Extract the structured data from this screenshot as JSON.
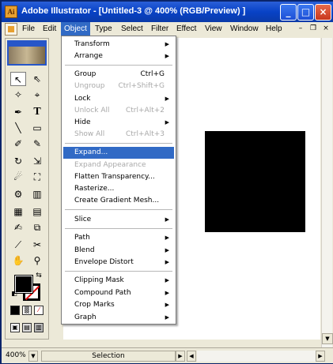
{
  "window": {
    "title": "Adobe Illustrator - [Untitled-3 @ 400% (RGB/Preview) ]",
    "app_icon_text": "Ai",
    "controls": {
      "minimize": "_",
      "maximize": "□",
      "close": "×"
    }
  },
  "menubar": {
    "items": [
      "File",
      "Edit",
      "Object",
      "Type",
      "Select",
      "Filter",
      "Effect",
      "View",
      "Window",
      "Help"
    ],
    "active": "Object",
    "mdi": {
      "minimize": "–",
      "restore": "❐",
      "close": "×"
    }
  },
  "object_menu": {
    "items": [
      {
        "label": "Transform",
        "shortcut": "",
        "submenu": true,
        "disabled": false
      },
      {
        "label": "Arrange",
        "shortcut": "",
        "submenu": true,
        "disabled": false
      },
      {
        "label": "Group",
        "shortcut": "Ctrl+G",
        "submenu": false,
        "disabled": false
      },
      {
        "label": "Ungroup",
        "shortcut": "Ctrl+Shift+G",
        "submenu": false,
        "disabled": true
      },
      {
        "label": "Lock",
        "shortcut": "",
        "submenu": true,
        "disabled": false
      },
      {
        "label": "Unlock All",
        "shortcut": "Ctrl+Alt+2",
        "submenu": false,
        "disabled": true
      },
      {
        "label": "Hide",
        "shortcut": "",
        "submenu": true,
        "disabled": false
      },
      {
        "label": "Show All",
        "shortcut": "Ctrl+Alt+3",
        "submenu": false,
        "disabled": true
      },
      {
        "label": "Expand...",
        "shortcut": "",
        "submenu": false,
        "disabled": false,
        "highlighted": true
      },
      {
        "label": "Expand Appearance",
        "shortcut": "",
        "submenu": false,
        "disabled": true
      },
      {
        "label": "Flatten Transparency...",
        "shortcut": "",
        "submenu": false,
        "disabled": false
      },
      {
        "label": "Rasterize...",
        "shortcut": "",
        "submenu": false,
        "disabled": false
      },
      {
        "label": "Create Gradient Mesh...",
        "shortcut": "",
        "submenu": false,
        "disabled": false
      },
      {
        "label": "Slice",
        "shortcut": "",
        "submenu": true,
        "disabled": false
      },
      {
        "label": "Path",
        "shortcut": "",
        "submenu": true,
        "disabled": false
      },
      {
        "label": "Blend",
        "shortcut": "",
        "submenu": true,
        "disabled": false
      },
      {
        "label": "Envelope Distort",
        "shortcut": "",
        "submenu": true,
        "disabled": false
      },
      {
        "label": "Clipping Mask",
        "shortcut": "",
        "submenu": true,
        "disabled": false
      },
      {
        "label": "Compound Path",
        "shortcut": "",
        "submenu": true,
        "disabled": false
      },
      {
        "label": "Crop Marks",
        "shortcut": "",
        "submenu": true,
        "disabled": false
      },
      {
        "label": "Graph",
        "shortcut": "",
        "submenu": true,
        "disabled": false
      }
    ]
  },
  "toolbox": {
    "tools": [
      "selection-tool",
      "direct-selection-tool",
      "magic-wand-tool",
      "lasso-tool",
      "pen-tool",
      "type-tool",
      "line-segment-tool",
      "rectangle-tool",
      "paintbrush-tool",
      "pencil-tool",
      "rotate-tool",
      "scale-tool",
      "warp-tool",
      "free-transform-tool",
      "symbol-sprayer-tool",
      "column-graph-tool",
      "mesh-tool",
      "gradient-tool",
      "eyedropper-tool",
      "blend-tool",
      "slice-tool",
      "scissors-tool",
      "hand-tool",
      "zoom-tool"
    ],
    "fill_color": "#000000",
    "stroke_color": "#000000"
  },
  "document": {
    "artwork_color": "#000000"
  },
  "statusbar": {
    "zoom": "400%",
    "status": "Selection"
  }
}
